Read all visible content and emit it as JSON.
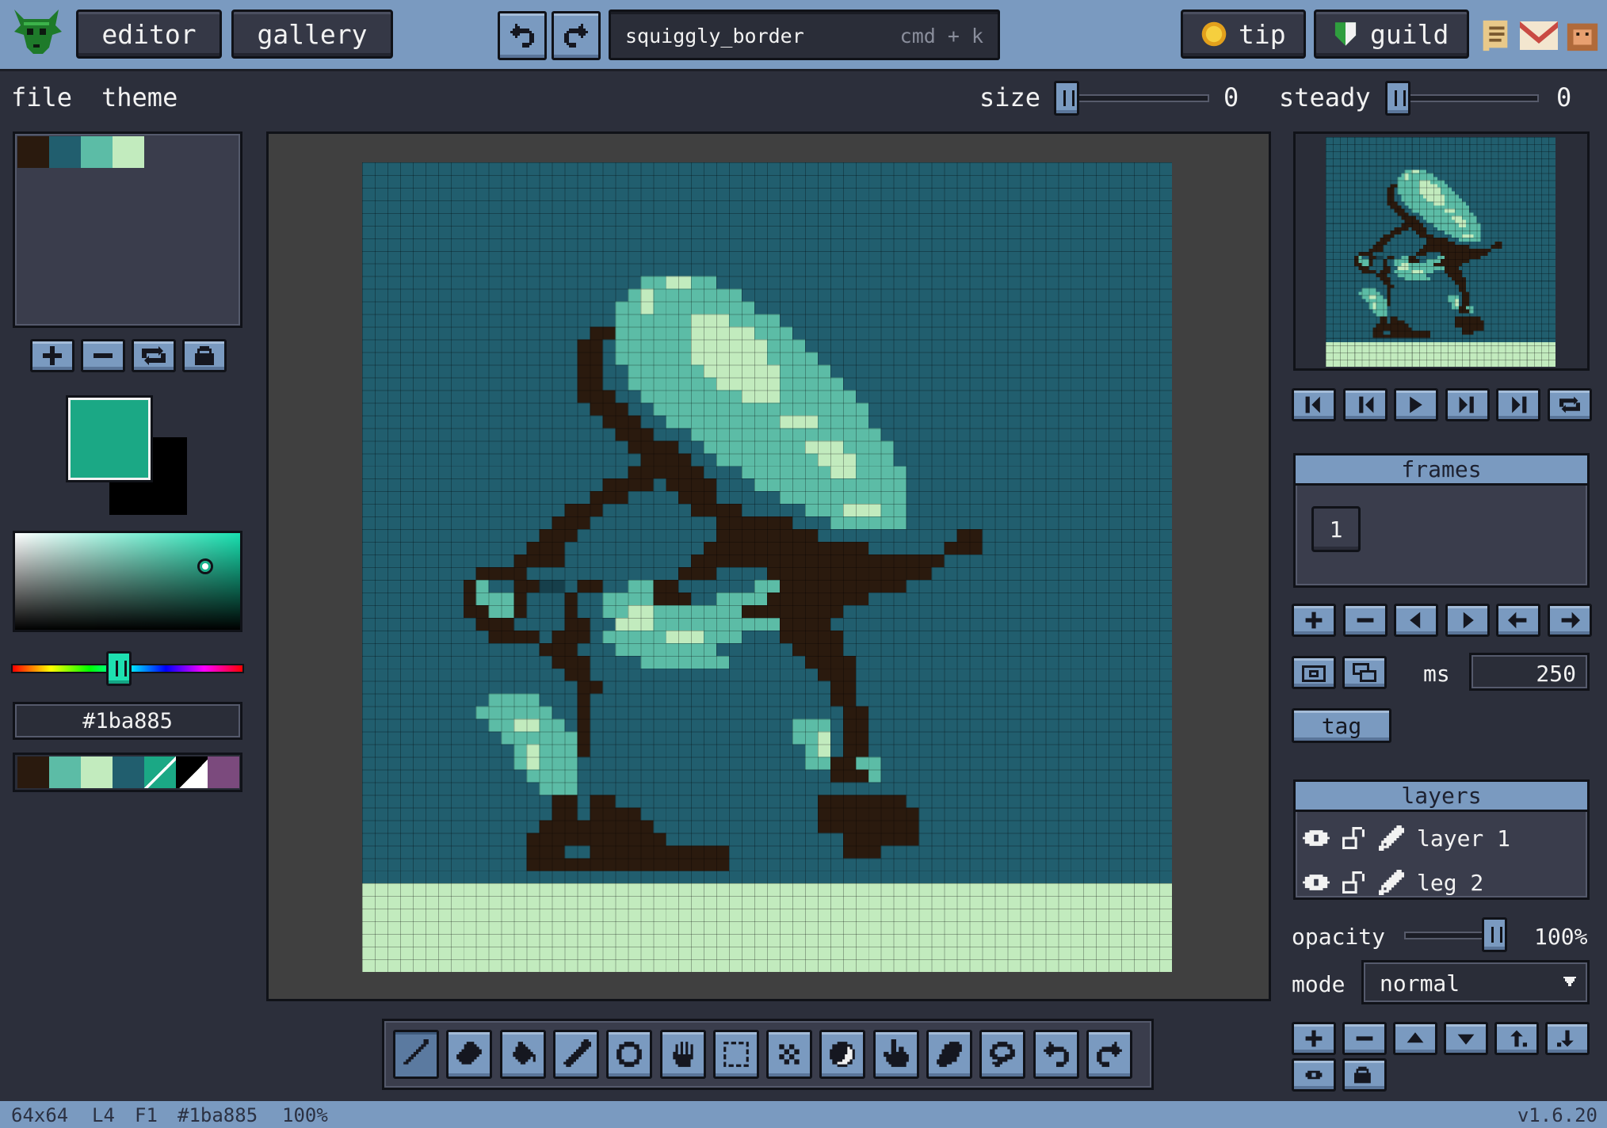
{
  "topbar": {
    "editor_label": "editor",
    "gallery_label": "gallery",
    "search_text": "squiggly_border",
    "search_shortcut": "cmd + k",
    "tip_label": "tip",
    "guild_label": "guild"
  },
  "menu": {
    "file": "file",
    "theme": "theme"
  },
  "brush": {
    "size_label": "size",
    "size_value": "0",
    "steady_label": "steady",
    "steady_value": "0"
  },
  "colors": {
    "primary": "#1ba885",
    "secondary": "#000000",
    "hex_value": "#1ba885",
    "palette": [
      "#2a1a0e",
      "#215e6e",
      "#5cbca6",
      "#c2ebbe"
    ],
    "recent": [
      "#2a1a0e",
      "#5cbca6",
      "#c2ebbe",
      "#215e6e",
      "#1ba885",
      "#000000",
      "#7b4a7d"
    ]
  },
  "frames": {
    "title": "frames",
    "items": [
      "1"
    ],
    "ms_label": "ms",
    "ms_value": "250",
    "tag_label": "tag"
  },
  "layers": {
    "title": "layers",
    "items": [
      {
        "name": "layer 1"
      },
      {
        "name": "leg 2"
      }
    ],
    "opacity_label": "opacity",
    "opacity_value": "100%",
    "mode_label": "mode",
    "mode_value": "normal"
  },
  "tools": [
    "pencil-icon",
    "eraser-icon",
    "bucket-icon",
    "eyedropper-icon",
    "circle-icon",
    "hand-icon",
    "select-rect-icon",
    "dither-icon",
    "shade-icon",
    "pointer-icon",
    "fill-shape-icon",
    "lasso-icon",
    "undo-icon",
    "redo-icon"
  ],
  "status": {
    "size": "64x64",
    "layer": "L4",
    "frame": "F1",
    "color": "#1ba885",
    "zoom": "100%",
    "version": "v1.6.20"
  }
}
